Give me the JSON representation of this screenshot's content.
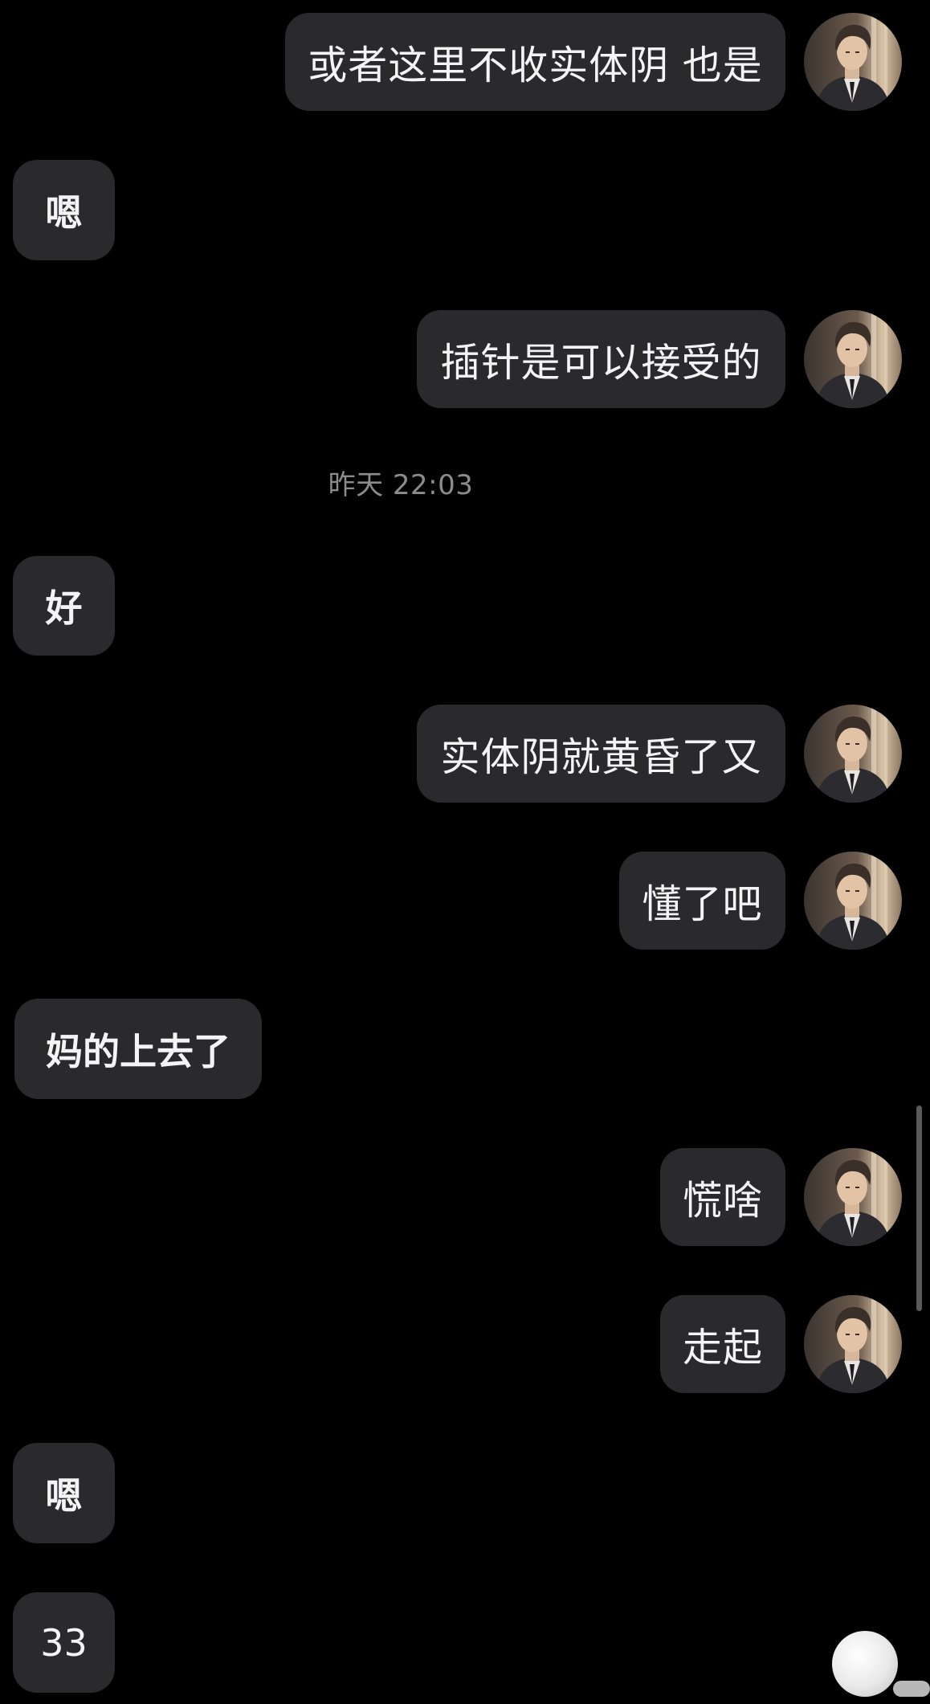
{
  "chat": {
    "timestamp": "昨天 22:03",
    "messages": [
      {
        "side": "out",
        "text": "或者这里不收实体阴 也是"
      },
      {
        "side": "in",
        "text": "嗯"
      },
      {
        "side": "out",
        "text": "插针是可以接受的"
      },
      {
        "side": "in",
        "text": "好"
      },
      {
        "side": "out",
        "text": "实体阴就黄昏了又"
      },
      {
        "side": "out",
        "text": "懂了吧"
      },
      {
        "side": "in",
        "text": "妈的上去了"
      },
      {
        "side": "out",
        "text": "慌啥"
      },
      {
        "side": "out",
        "text": "走起"
      },
      {
        "side": "in",
        "text": "嗯"
      },
      {
        "side": "in",
        "text": "33"
      }
    ]
  },
  "icons": {
    "avatar": "user-avatar-icon",
    "float_ball": "floating-assistant-icon"
  },
  "colors": {
    "background": "#000000",
    "bubble": "#2a2a2c",
    "text": "#f4f4f4",
    "timestamp": "#8c8c8c"
  }
}
